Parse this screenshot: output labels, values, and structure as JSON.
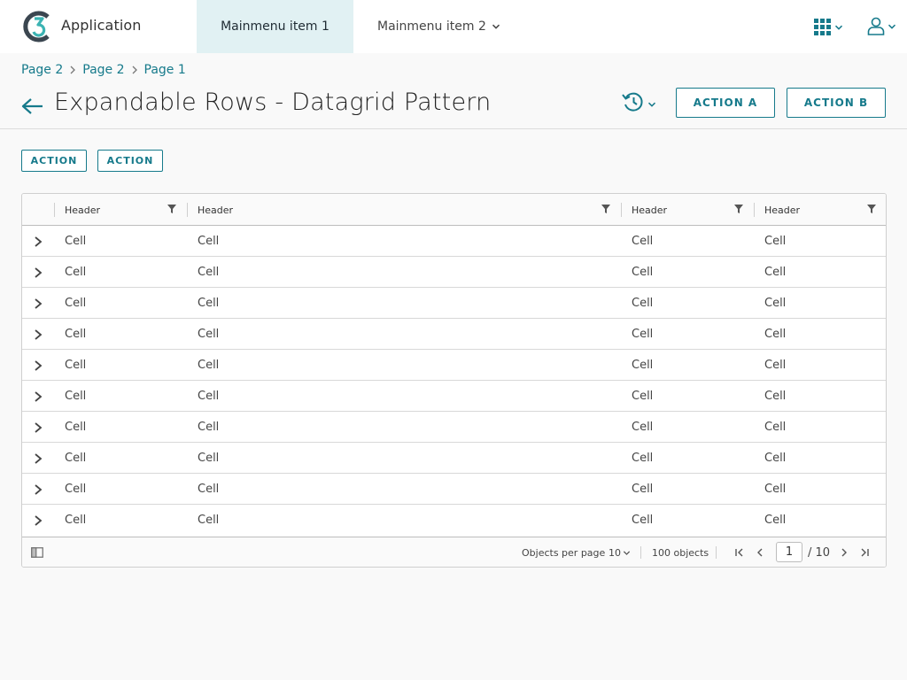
{
  "header": {
    "app_name": "Application",
    "nav": [
      {
        "label": "Mainmenu item 1",
        "active": true
      },
      {
        "label": "Mainmenu item 2",
        "has_dropdown": true
      }
    ],
    "icons": {
      "apps": "grid-icon",
      "user": "user-icon"
    }
  },
  "breadcrumb": [
    "Page 2",
    "Page 2",
    "Page 1"
  ],
  "page": {
    "title": "Expandable Rows - Datagrid Pattern",
    "action_a": "ACTION A",
    "action_b": "ACTION B"
  },
  "actions": [
    "ACTION",
    "ACTION"
  ],
  "grid": {
    "headers": [
      "Header",
      "Header",
      "Header",
      "Header"
    ],
    "rows": [
      [
        "Cell",
        "Cell",
        "Cell",
        "Cell"
      ],
      [
        "Cell",
        "Cell",
        "Cell",
        "Cell"
      ],
      [
        "Cell",
        "Cell",
        "Cell",
        "Cell"
      ],
      [
        "Cell",
        "Cell",
        "Cell",
        "Cell"
      ],
      [
        "Cell",
        "Cell",
        "Cell",
        "Cell"
      ],
      [
        "Cell",
        "Cell",
        "Cell",
        "Cell"
      ],
      [
        "Cell",
        "Cell",
        "Cell",
        "Cell"
      ],
      [
        "Cell",
        "Cell",
        "Cell",
        "Cell"
      ],
      [
        "Cell",
        "Cell",
        "Cell",
        "Cell"
      ],
      [
        "Cell",
        "Cell",
        "Cell",
        "Cell"
      ]
    ],
    "footer": {
      "per_page_label": "Objects per page",
      "per_page_value": "10",
      "total": "100 objects",
      "current_page": "1",
      "total_pages": "/ 10"
    }
  },
  "colors": {
    "accent": "#167a8b",
    "active_nav_bg": "#e1f1f3"
  }
}
